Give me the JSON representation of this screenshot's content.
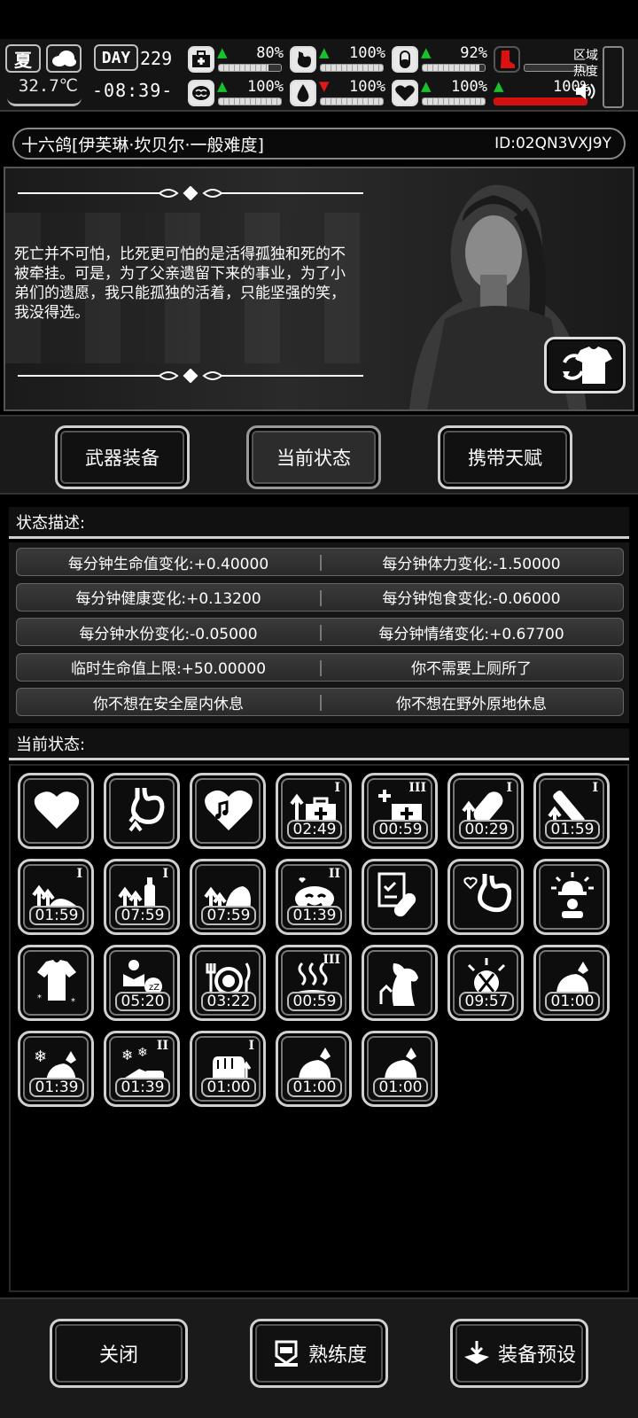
{
  "hud": {
    "season": "夏",
    "temperature": "32.7℃",
    "day_label": "DAY",
    "day_number": "229",
    "clock": "-08:39-",
    "stats": [
      {
        "icon": "medkit-icon",
        "arrow": "up",
        "value": "80%",
        "level": 0.8
      },
      {
        "icon": "stomach-icon",
        "arrow": "up",
        "value": "100%",
        "level": 1.0
      },
      {
        "icon": "capsule-icon",
        "arrow": "up",
        "value": "92%",
        "level": 0.92
      },
      {
        "icon": "boot-icon",
        "arrow": "",
        "value": "",
        "level": 0
      },
      {
        "icon": "brain-icon",
        "arrow": "up",
        "value": "100%",
        "level": 1.0
      },
      {
        "icon": "water-drop-icon",
        "arrow": "down",
        "value": "100%",
        "level": 1.0
      },
      {
        "icon": "heart-icon",
        "arrow": "up",
        "value": "100%",
        "level": 1.0
      },
      {
        "icon": "stamina-icon",
        "arrow": "up",
        "value": "100%",
        "level": 1.0
      }
    ],
    "zone_label": "区域热度"
  },
  "character": {
    "name": "十六鸽[伊芙琳·坎贝尔·一般难度]",
    "id": "ID:02QN3VXJ9Y",
    "quote": "死亡并不可怕，比死更可怕的是活得孤独和死的不被牵挂。可是，为了父亲遗留下来的事业，为了小弟们的遗愿，我只能孤独的活着，只能坚强的笑，我没得选。"
  },
  "tabs": {
    "weapons": "武器装备",
    "status": "当前状态",
    "talents": "携带天赋"
  },
  "status_desc": {
    "title": "状态描述:",
    "rows": [
      [
        "每分钟生命值变化:+0.40000",
        "每分钟体力变化:-1.50000"
      ],
      [
        "每分钟健康变化:+0.13200",
        "每分钟饱食变化:-0.06000"
      ],
      [
        "每分钟水份变化:-0.05000",
        "每分钟情绪变化:+0.67700"
      ],
      [
        "临时生命值上限:+50.00000",
        "你不需要上厕所了"
      ],
      [
        "你不想在安全屋内休息",
        "你不想在野外原地休息"
      ]
    ]
  },
  "current_status": {
    "title": "当前状态:",
    "effects": [
      {
        "icon": "heart-icon",
        "timer": "",
        "level": ""
      },
      {
        "icon": "stomach-up-icon",
        "timer": "",
        "level": ""
      },
      {
        "icon": "music-heart-icon",
        "timer": "",
        "level": ""
      },
      {
        "icon": "medkit-up-icon",
        "timer": "02:49",
        "level": "I"
      },
      {
        "icon": "medkit-plus-icon",
        "timer": "00:59",
        "level": "III"
      },
      {
        "icon": "capsule-up-icon",
        "timer": "00:29",
        "level": "I"
      },
      {
        "icon": "bandage-up-icon",
        "timer": "01:59",
        "level": "I"
      },
      {
        "icon": "food-up-icon",
        "timer": "01:59",
        "level": "I"
      },
      {
        "icon": "bottle-up-icon",
        "timer": "07:59",
        "level": "I"
      },
      {
        "icon": "leaf-up-icon",
        "timer": "07:59",
        "level": ""
      },
      {
        "icon": "happy-face-icon",
        "timer": "01:39",
        "level": "II"
      },
      {
        "icon": "prescription-pill-icon",
        "timer": "",
        "level": ""
      },
      {
        "icon": "stomach-heart-icon",
        "timer": "",
        "level": ""
      },
      {
        "icon": "alarm-person-icon",
        "timer": "",
        "level": ""
      },
      {
        "icon": "shirt-icon",
        "timer": "",
        "level": ""
      },
      {
        "icon": "sleepy-person-icon",
        "timer": "05:20",
        "level": ""
      },
      {
        "icon": "dinner-plate-icon",
        "timer": "03:22",
        "level": ""
      },
      {
        "icon": "hot-steam-icon",
        "timer": "00:59",
        "level": "III"
      },
      {
        "icon": "horse-head-icon",
        "timer": "",
        "level": ""
      },
      {
        "icon": "headache-icon",
        "timer": "09:57",
        "level": ""
      },
      {
        "icon": "food-bag-icon",
        "timer": "01:00",
        "level": ""
      },
      {
        "icon": "frozen-bag-icon",
        "timer": "01:39",
        "level": ""
      },
      {
        "icon": "frozen-meat-icon",
        "timer": "01:39",
        "level": "II"
      },
      {
        "icon": "fist-icon",
        "timer": "01:00",
        "level": "I"
      },
      {
        "icon": "food-bag-icon",
        "timer": "01:00",
        "level": ""
      },
      {
        "icon": "food-bag-icon",
        "timer": "01:00",
        "level": ""
      }
    ]
  },
  "bottom": {
    "close": "关闭",
    "proficiency": "熟练度",
    "preset": "装备预设"
  },
  "colors": {
    "arrow_up": "#18c22a",
    "arrow_down": "#e01818",
    "alert_red": "#d11111"
  }
}
